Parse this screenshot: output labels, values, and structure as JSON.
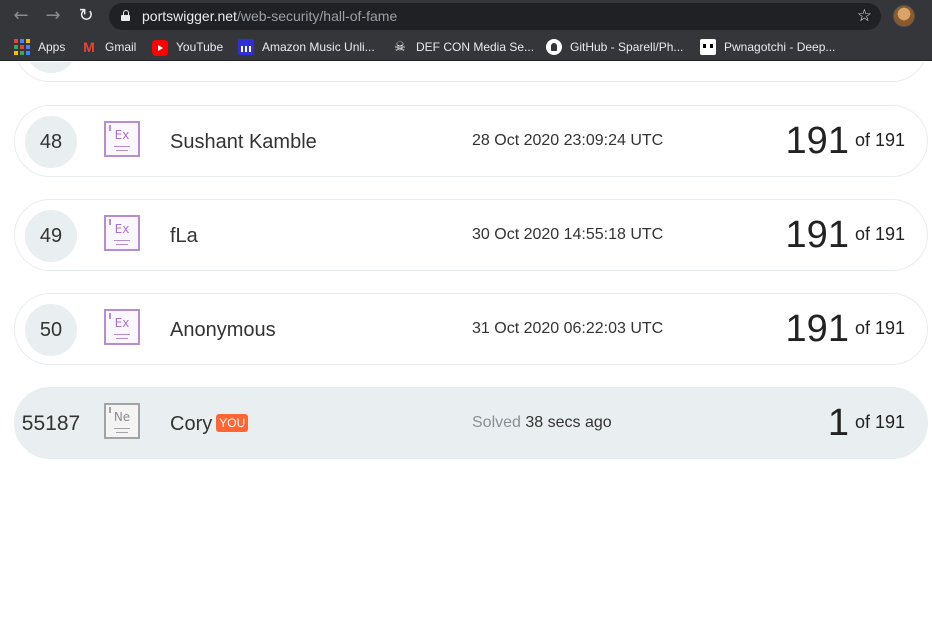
{
  "browser": {
    "url_host": "portswigger.net",
    "url_path": "/web-security/hall-of-fame",
    "back_icon": "←",
    "forward_icon": "→",
    "reload_icon": "↻",
    "star_icon": "☆"
  },
  "bookmarks": [
    {
      "label": "Apps",
      "icon": "apps-grid-icon"
    },
    {
      "label": "Gmail",
      "icon": "gmail-icon"
    },
    {
      "label": "YouTube",
      "icon": "youtube-icon"
    },
    {
      "label": "Amazon Music Unli...",
      "icon": "amazon-music-icon"
    },
    {
      "label": "DEF CON Media Se...",
      "icon": "defcon-icon"
    },
    {
      "label": "GitHub - Sparell/Ph...",
      "icon": "github-icon"
    },
    {
      "label": "Pwnagotchi - Deep...",
      "icon": "pwnagotchi-icon"
    }
  ],
  "leaderboard": [
    {
      "rank": "48",
      "level": "Ex",
      "name": "Sushant Kamble",
      "date": "28 Oct 2020 23:09:24 UTC",
      "solved": "191",
      "of_label": "of 191"
    },
    {
      "rank": "49",
      "level": "Ex",
      "name": "fLa",
      "date": "30 Oct 2020 14:55:18 UTC",
      "solved": "191",
      "of_label": "of 191"
    },
    {
      "rank": "50",
      "level": "Ex",
      "name": "Anonymous",
      "date": "31 Oct 2020 06:22:03 UTC",
      "solved": "191",
      "of_label": "of 191"
    }
  ],
  "me": {
    "rank": "55187",
    "level": "Ne",
    "name": "Cory",
    "you_badge": "YOU",
    "solved_prefix": "Solved",
    "solved_ago": "38 secs ago",
    "solved": "1",
    "of_label": "of 191"
  },
  "colors": {
    "accent_orange": "#ff6633",
    "expert_purple": "#b48ed1",
    "row_highlight": "#e9eef0"
  }
}
